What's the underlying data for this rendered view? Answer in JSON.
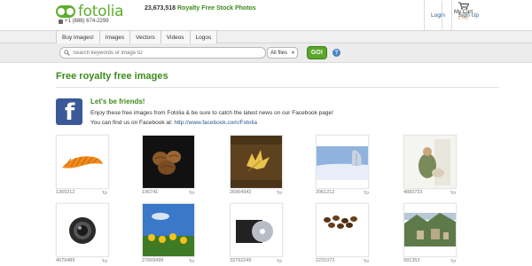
{
  "header": {
    "logo_text": "fotolia",
    "phone": "+1 (888) 674-2299",
    "tagline_count": "23,673,518",
    "tagline_text": "Royalty Free Stock Photos",
    "login_label": "Login",
    "signup_label": "Sign Up",
    "cart_label": "My Cart",
    "cart_count": "( 0 )"
  },
  "nav": {
    "tabs": [
      "Buy images!",
      "Images",
      "Vectors",
      "Videos",
      "Logos"
    ]
  },
  "search": {
    "placeholder": "Search keywords or image ID",
    "filter_value": "All files",
    "go_label": "GO!",
    "help_label": "?"
  },
  "main": {
    "title": "Free royalty free images"
  },
  "facebook": {
    "logo_letter": "f",
    "heading": "Let's be friends!",
    "text": "Enjoy these free images from Fotolia & be sure to catch the latest news on our Facebook page!",
    "link_prefix": "You can find us on Facebook at:",
    "url": "http://www.facebook.com/Fotolia"
  },
  "thumbnails": [
    {
      "id": "1369212",
      "subject": "orange-peel-strips"
    },
    {
      "id": "196741",
      "subject": "walnuts"
    },
    {
      "id": "26904942",
      "subject": "autumn-leaf-on-soil"
    },
    {
      "id": "2061212",
      "subject": "winter-landscape"
    },
    {
      "id": "4883733",
      "subject": "person-with-dog"
    },
    {
      "id": "4079489",
      "subject": "camera-lens"
    },
    {
      "id": "27669499",
      "subject": "sunflowers-blue-sky"
    },
    {
      "id": "33792249",
      "subject": "cd-disc-case"
    },
    {
      "id": "2231072",
      "subject": "coffee-beans"
    },
    {
      "id": "991353",
      "subject": "mountain-village"
    }
  ],
  "colors": {
    "brand_green": "#5fae2e",
    "title_green": "#3d8b1a",
    "link_blue": "#245a8a",
    "facebook_blue": "#3b5998"
  }
}
